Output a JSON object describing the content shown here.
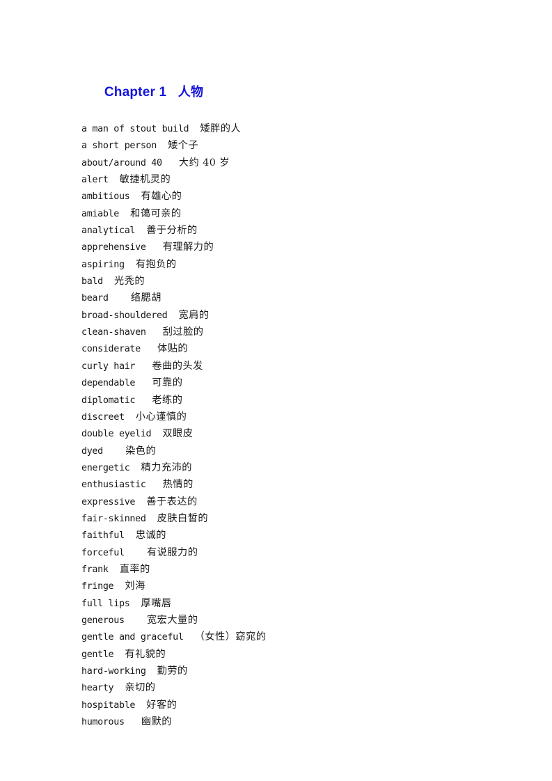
{
  "document": {
    "page_background": "#ffffff",
    "text_color": "#1a1a1a",
    "heading_color": "#1414dc"
  },
  "heading": {
    "chapter_label": "Chapter 1",
    "chapter_topic": "人物",
    "full": "Chapter 1   人物"
  },
  "vocabulary": [
    {
      "term": "a man of stout build",
      "gap": 2,
      "gloss": "矮胖的人"
    },
    {
      "term": "a short person",
      "gap": 2,
      "gloss": "矮个子"
    },
    {
      "term": "about/around 40",
      "gap": 3,
      "gloss": "大约 40 岁"
    },
    {
      "term": "alert",
      "gap": 2,
      "gloss": "敏捷机灵的"
    },
    {
      "term": "ambitious",
      "gap": 2,
      "gloss": "有雄心的"
    },
    {
      "term": "amiable",
      "gap": 2,
      "gloss": "和蔼可亲的"
    },
    {
      "term": "analytical",
      "gap": 2,
      "gloss": "善于分析的"
    },
    {
      "term": "apprehensive",
      "gap": 3,
      "gloss": "有理解力的"
    },
    {
      "term": "aspiring",
      "gap": 2,
      "gloss": "有抱负的"
    },
    {
      "term": "bald",
      "gap": 2,
      "gloss": "光秃的"
    },
    {
      "term": "beard",
      "gap": 4,
      "gloss": "络腮胡"
    },
    {
      "term": "broad-shouldered",
      "gap": 2,
      "gloss": "宽肩的"
    },
    {
      "term": "clean-shaven",
      "gap": 3,
      "gloss": "刮过脸的"
    },
    {
      "term": "considerate",
      "gap": 3,
      "gloss": "体贴的"
    },
    {
      "term": "curly hair",
      "gap": 3,
      "gloss": "卷曲的头发"
    },
    {
      "term": "dependable",
      "gap": 3,
      "gloss": "可靠的"
    },
    {
      "term": "diplomatic",
      "gap": 3,
      "gloss": "老练的"
    },
    {
      "term": "discreet",
      "gap": 2,
      "gloss": "小心谨慎的"
    },
    {
      "term": "double eyelid",
      "gap": 2,
      "gloss": "双眼皮"
    },
    {
      "term": "dyed",
      "gap": 4,
      "gloss": "染色的"
    },
    {
      "term": "energetic",
      "gap": 2,
      "gloss": "精力充沛的"
    },
    {
      "term": "enthusiastic",
      "gap": 3,
      "gloss": "热情的"
    },
    {
      "term": "expressive",
      "gap": 2,
      "gloss": "善于表达的"
    },
    {
      "term": "fair-skinned",
      "gap": 2,
      "gloss": "皮肤白皙的"
    },
    {
      "term": "faithful",
      "gap": 2,
      "gloss": "忠诚的"
    },
    {
      "term": "forceful",
      "gap": 4,
      "gloss": "有说服力的"
    },
    {
      "term": "frank",
      "gap": 2,
      "gloss": "直率的"
    },
    {
      "term": "fringe",
      "gap": 2,
      "gloss": "刘海"
    },
    {
      "term": "full lips",
      "gap": 2,
      "gloss": "厚嘴唇"
    },
    {
      "term": "generous",
      "gap": 4,
      "gloss": "宽宏大量的"
    },
    {
      "term": "gentle and graceful",
      "gap": 2,
      "gloss": "（女性）窈窕的"
    },
    {
      "term": "gentle",
      "gap": 2,
      "gloss": "有礼貌的"
    },
    {
      "term": "hard-working",
      "gap": 2,
      "gloss": "勤劳的"
    },
    {
      "term": "hearty",
      "gap": 2,
      "gloss": "亲切的"
    },
    {
      "term": "hospitable",
      "gap": 2,
      "gloss": "好客的"
    },
    {
      "term": "humorous",
      "gap": 3,
      "gloss": "幽默的"
    }
  ]
}
